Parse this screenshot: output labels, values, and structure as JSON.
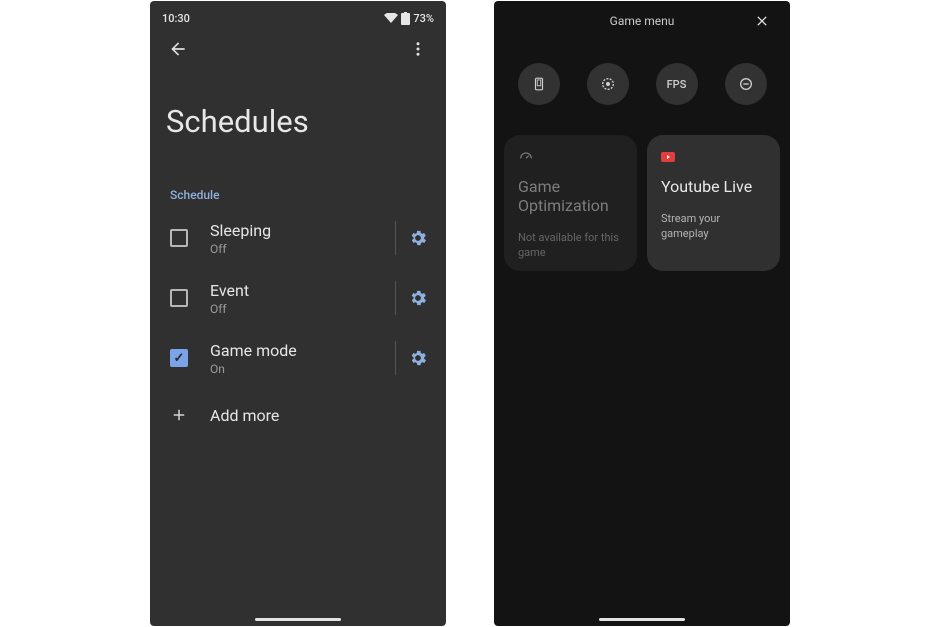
{
  "left": {
    "statusbar": {
      "time": "10:30",
      "battery": "73%"
    },
    "page_title": "Schedules",
    "section_label": "Schedule",
    "items": [
      {
        "title": "Sleeping",
        "status": "Off",
        "checked": false
      },
      {
        "title": "Event",
        "status": "Off",
        "checked": false
      },
      {
        "title": "Game mode",
        "status": "On",
        "checked": true
      }
    ],
    "add_more": "Add more"
  },
  "right": {
    "header": "Game menu",
    "pill_fps": "FPS",
    "cards": {
      "opt": {
        "title": "Game Optimization",
        "sub": "Not available for this game"
      },
      "yt": {
        "title": "Youtube Live",
        "sub": "Stream your gameplay"
      }
    }
  }
}
